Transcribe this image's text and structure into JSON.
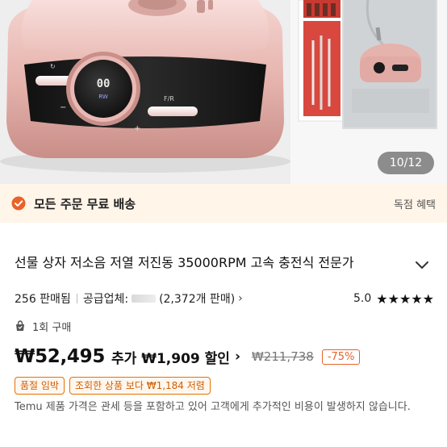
{
  "gallery": {
    "counter": "10/12"
  },
  "device": {
    "display_digits": "00",
    "display_unit": "RW",
    "left_label": "↻",
    "right_label": "F/R",
    "minus": "−",
    "plus": "+"
  },
  "shipping": {
    "text": "모든 주문 무료 배송",
    "right": "독점 혜택"
  },
  "product": {
    "title": "선물 상자 저소음 저열 저진동 35000RPM 고속 충전식 전문가"
  },
  "meta": {
    "sold": "256 판매됨",
    "supplier_label": "공급업체:",
    "supplier_sales": "(2,372개 판매)",
    "rating": "5.0",
    "stars": "★★★★★"
  },
  "purchase": {
    "count": "1회 구매"
  },
  "price": {
    "current": "₩52,495",
    "extra": "추가 ₩1,909 할인",
    "original": "₩211,738",
    "discount": "-75%"
  },
  "badges": [
    "품절 임박",
    "조회한 상품 보다 ₩1,184 저렴"
  ],
  "disclaimer": "Temu 제품 가격은 관세 등을 포함하고 있어 고객에게 추가적인 비용이 발생하지 않습니다.",
  "colors": {
    "banner_bg": "#fff5e9",
    "accent_orange": "#e8622a",
    "badge_orange": "#e57200",
    "device_pink": "#e8b9b5"
  }
}
